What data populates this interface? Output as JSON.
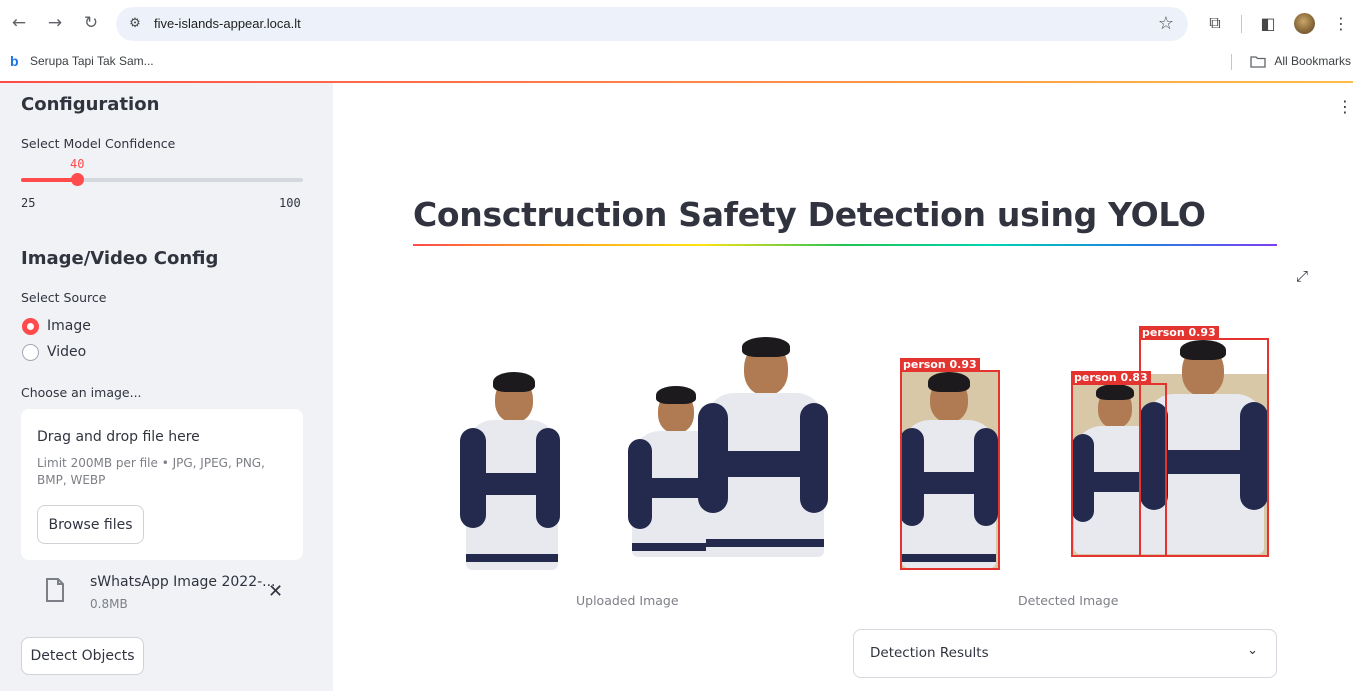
{
  "browser": {
    "url": "five-islands-appear.loca.lt",
    "bookmark": "Serupa Tapi Tak Sam...",
    "all_bookmarks": "All Bookmarks"
  },
  "sidebar": {
    "config_heading": "Configuration",
    "confidence_label": "Select Model Confidence",
    "confidence_value": "40",
    "confidence_min": "25",
    "confidence_max": "100",
    "source_heading": "Image/Video Config",
    "source_label": "Select Source",
    "source_options": [
      "Image",
      "Video"
    ],
    "source_selected": "Image",
    "choose_label": "Choose an image...",
    "dropzone_title": "Drag and drop file here",
    "dropzone_limit": "Limit 200MB per file • JPG, JPEG, PNG, BMP, WEBP",
    "browse_label": "Browse files",
    "file_name": "sWhatsApp Image 2022-...",
    "file_size": "0.8MB",
    "detect_label": "Detect Objects"
  },
  "main": {
    "title": "Consctruction Safety Detection using YOLO",
    "uploaded_caption": "Uploaded Image",
    "detected_caption": "Detected Image",
    "detections": [
      "person 0.93",
      "person 0.83",
      "person 0.93"
    ],
    "expander_label": "Detection Results"
  },
  "colors": {
    "accent": "#ff4b4b",
    "sidebar_bg": "#f0f2f6",
    "bbox": "#e3342f"
  }
}
